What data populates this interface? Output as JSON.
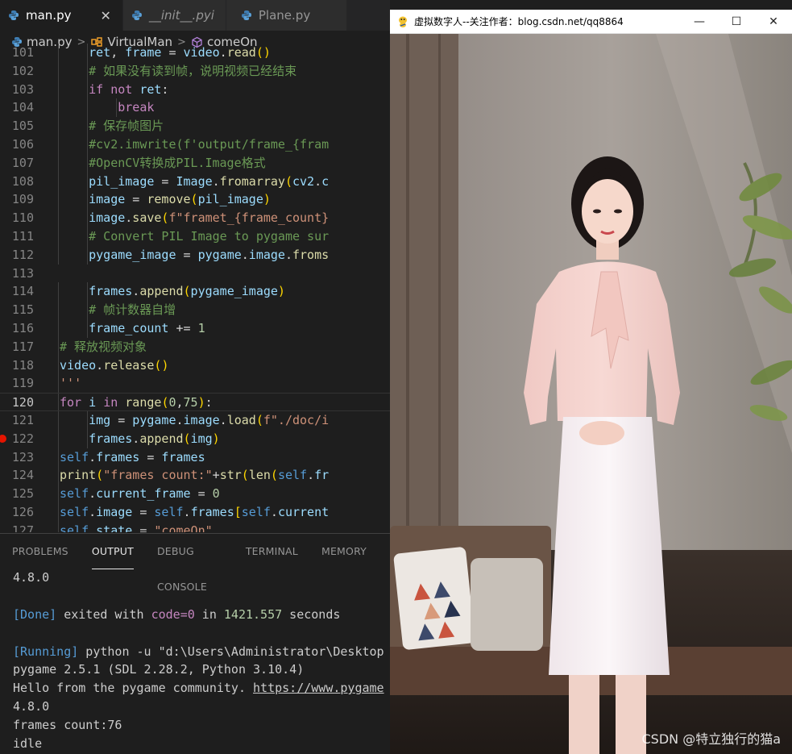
{
  "tabs": [
    {
      "label": "man.py",
      "active": true,
      "close": "✕"
    },
    {
      "label": "__init__.pyi",
      "active": false
    },
    {
      "label": "Plane.py",
      "active": false
    }
  ],
  "breadcrumb": {
    "file": "man.py",
    "class": "VirtualMan",
    "method": "comeOn"
  },
  "code_lines": [
    {
      "n": "101",
      "text": "ret, frame = video.read()"
    },
    {
      "n": "102",
      "text": "# 如果没有读到帧，说明视频已经结束"
    },
    {
      "n": "103",
      "text": "if not ret:"
    },
    {
      "n": "104",
      "text": "break"
    },
    {
      "n": "105",
      "text": "# 保存帧图片"
    },
    {
      "n": "106",
      "text": "#cv2.imwrite(f'output/frame_{fram"
    },
    {
      "n": "107",
      "text": "#OpenCV转换成PIL.Image格式"
    },
    {
      "n": "108",
      "text": "pil_image = Image.fromarray(cv2.c"
    },
    {
      "n": "109",
      "text": "image = remove(pil_image)"
    },
    {
      "n": "110",
      "text": "image.save(f\"framet_{frame_count}"
    },
    {
      "n": "111",
      "text": "# Convert PIL Image to pygame sur"
    },
    {
      "n": "112",
      "text": "pygame_image = pygame.image.froms"
    },
    {
      "n": "113",
      "text": ""
    },
    {
      "n": "114",
      "text": "frames.append(pygame_image)"
    },
    {
      "n": "115",
      "text": "# 帧计数器自增"
    },
    {
      "n": "116",
      "text": "frame_count += 1"
    },
    {
      "n": "117",
      "text": "# 释放视频对象"
    },
    {
      "n": "118",
      "text": "video.release()"
    },
    {
      "n": "119",
      "text": "'''"
    },
    {
      "n": "120",
      "text": "for i in range(0,75):"
    },
    {
      "n": "121",
      "text": "img = pygame.image.load(f\"./doc/i"
    },
    {
      "n": "122",
      "text": "frames.append(img)"
    },
    {
      "n": "123",
      "text": "self.frames = frames"
    },
    {
      "n": "124",
      "text": "print(\"frames count:\"+str(len(self.fr"
    },
    {
      "n": "125",
      "text": "self.current_frame = 0"
    },
    {
      "n": "126",
      "text": "self.image = self.frames[self.current"
    },
    {
      "n": "127",
      "text": "self.state = \"comeOn\""
    }
  ],
  "panel_tabs": [
    "PROBLEMS",
    "OUTPUT",
    "DEBUG CONSOLE",
    "TERMINAL",
    "MEMORY"
  ],
  "output": {
    "l1": "4.8.0",
    "done_tag": "[Done]",
    "done_text1": " exited with ",
    "done_code": "code=0",
    "done_text2": " in ",
    "done_secs": "1421.557",
    "done_text3": " seconds",
    "running_tag": "[Running]",
    "running_text": " python -u \"d:\\Users\\Administrator\\Desktop",
    "l4": "pygame 2.5.1 (SDL 2.28.2, Python 3.10.4)",
    "l5_text": "Hello from the pygame community. ",
    "l5_link": "https://www.pygame",
    "l6": "4.8.0",
    "l7": "frames count:76",
    "l8": "idle"
  },
  "window": {
    "title": "虚拟数字人--关注作者：blog.csdn.net/qq8864",
    "minimize": "—",
    "maximize": "☐",
    "close": "✕"
  },
  "watermark": "CSDN @特立独行的猫a",
  "colors": {
    "breakpoint": "#e51400",
    "accent_blue": "#569cd6"
  }
}
